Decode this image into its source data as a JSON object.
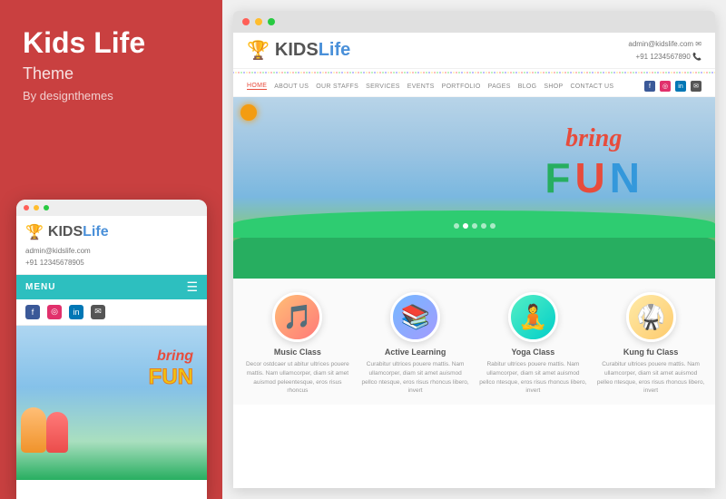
{
  "left": {
    "title": "Kids Life",
    "subtitle": "Theme",
    "by": "By designthemes"
  },
  "mobile_preview": {
    "logo": {
      "trophy": "🏆",
      "kids": "KIDS",
      "life": "Life"
    },
    "contact": {
      "email": "admin@kidslife.com",
      "phone": "+91 12345678905"
    },
    "menu_label": "MENU",
    "bring": "bring",
    "fun": "FUN"
  },
  "site_preview": {
    "logo": {
      "trophy": "🏆",
      "kids": "KIDS",
      "life": "Life"
    },
    "contact": {
      "email": "admin@kidslife.com ✉",
      "phone": "+91 1234567890 📞"
    },
    "nav": {
      "links": [
        "HOME",
        "ABOUT US",
        "OUR STAFFS",
        "SERVICES",
        "EVENTS",
        "PORTFOLIO",
        "PAGES",
        "BLOG",
        "SHOP",
        "CONTACT US"
      ],
      "active": "HOME"
    },
    "hero": {
      "bring": "bring",
      "fun_letters": [
        "F",
        "U",
        "N"
      ]
    },
    "features": [
      {
        "title": "Music Class",
        "desc": "Decor ostdcaer ut abitur ultrices pouere mattis. Nam ullamcorper, diam sit amet auismod peleentesque, eros risus rhoncus",
        "emoji": "🎵"
      },
      {
        "title": "Active Learning",
        "desc": "Curabitur ultrices pouere mattis. Nam ullamcorper, diam sit amet auismod pellco ntesque, eros risus rhoncus libero, invert",
        "emoji": "📚"
      },
      {
        "title": "Yoga Class",
        "desc": "Rabitur ultrices pouere mattis. Nam ullamcorper, diam sit amet auismod pellco ntesque, eros risus rhoncus libero, invert",
        "emoji": "🧘"
      },
      {
        "title": "Kung fu Class",
        "desc": "Curabitur ultrices pouere mattis. Nam ullamcorper, diam sit amet auismod pelleo ntesque, eros risus rhoncus libero, invert",
        "emoji": "🥋"
      }
    ]
  },
  "colors": {
    "accent_red": "#c94040",
    "teal": "#2dbfbf",
    "blue": "#4a90d9",
    "trophy": "#f5a623"
  }
}
